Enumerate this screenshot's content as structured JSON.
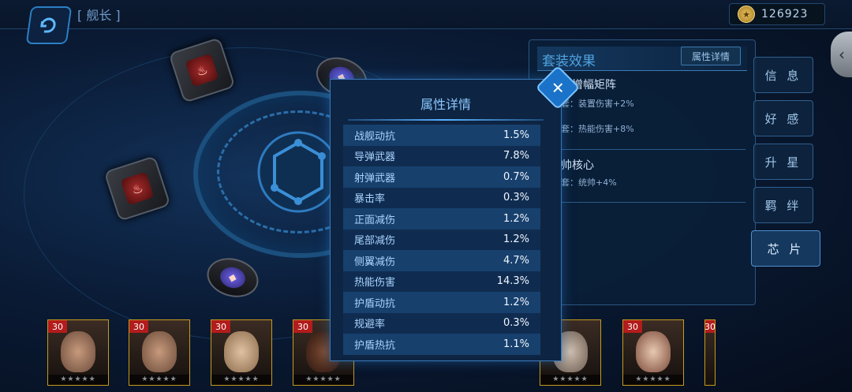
{
  "header": {
    "title": "[ 舰长 ]",
    "coins": "126923"
  },
  "suit_panel": {
    "title": "套装效果",
    "detail_button": "属性详情",
    "sets": [
      {
        "name": "增幅矩阵",
        "effects": [
          "套：装置伤害+2%",
          "套：热能伤害+8%"
        ]
      },
      {
        "name": "帅核心",
        "effects": [
          "套：统帅+4%"
        ]
      }
    ]
  },
  "side_tabs": [
    "信 息",
    "好 感",
    "升 星",
    "羁 绊",
    "芯 片"
  ],
  "modal": {
    "title": "属性详情",
    "attributes": [
      {
        "name": "战舰动抗",
        "value": "1.5%"
      },
      {
        "name": "导弹武器",
        "value": "7.8%"
      },
      {
        "name": "射弹武器",
        "value": "0.7%"
      },
      {
        "name": "暴击率",
        "value": "0.3%"
      },
      {
        "name": "正面减伤",
        "value": "1.2%"
      },
      {
        "name": "尾部减伤",
        "value": "1.2%"
      },
      {
        "name": "侧翼减伤",
        "value": "4.7%"
      },
      {
        "name": "热能伤害",
        "value": "14.3%"
      },
      {
        "name": "护盾动抗",
        "value": "1.2%"
      },
      {
        "name": "规避率",
        "value": "0.3%"
      },
      {
        "name": "护盾热抗",
        "value": "1.1%"
      }
    ]
  },
  "portraits": [
    {
      "level": "30"
    },
    {
      "level": "30"
    },
    {
      "level": "30"
    },
    {
      "level": "30"
    },
    {
      "level": "30"
    },
    {
      "level": "30"
    },
    {
      "level": "30"
    },
    {
      "level": "30"
    }
  ]
}
